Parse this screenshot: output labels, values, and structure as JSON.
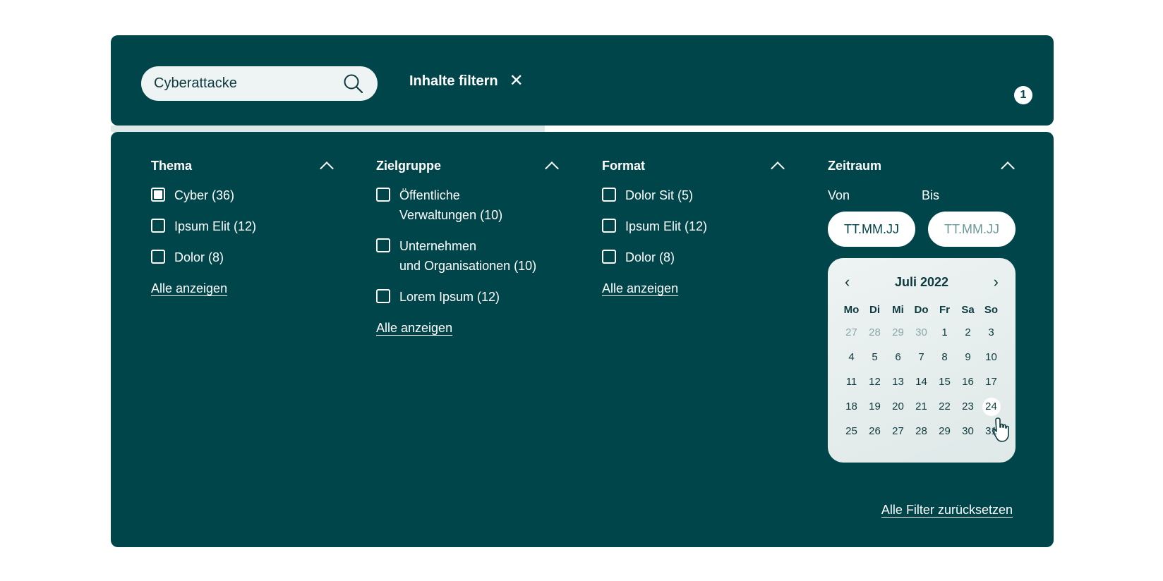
{
  "search": {
    "value": "Cyberattacke",
    "icon": "search-icon"
  },
  "filter_toggle": {
    "label": "Inhalte filtern",
    "close_icon": "✕"
  },
  "badge": {
    "count": "1"
  },
  "progress": {
    "fraction": 0.46
  },
  "columns": [
    {
      "title": "Thema",
      "options": [
        {
          "label": "Cyber  (36)",
          "checked": true
        },
        {
          "label": "Ipsum Elit  (12)",
          "checked": false
        },
        {
          "label": "Dolor  (8)",
          "checked": false
        }
      ],
      "show_all": "Alle anzeigen"
    },
    {
      "title": "Zielgruppe",
      "options": [
        {
          "label": "Öffentliche\nVerwaltungen   (10)",
          "checked": false
        },
        {
          "label": "Unternehmen\nund Organisationen  (10)",
          "checked": false
        },
        {
          "label": "Lorem Ipsum  (12)",
          "checked": false
        }
      ],
      "show_all": "Alle anzeigen"
    },
    {
      "title": "Format",
      "options": [
        {
          "label": "Dolor Sit  (5)",
          "checked": false
        },
        {
          "label": "Ipsum Elit  (12)",
          "checked": false
        },
        {
          "label": "Dolor  (8)",
          "checked": false
        }
      ],
      "show_all": "Alle anzeigen"
    }
  ],
  "zeitraum": {
    "title": "Zeitraum",
    "from_label": "Von",
    "to_label": "Bis",
    "from_placeholder": "TT.MM.JJ",
    "to_placeholder": "TT.MM.JJ",
    "calendar": {
      "month": "Juli 2022",
      "prev": "‹",
      "next": "›",
      "weekdays": [
        "Mo",
        "Di",
        "Mi",
        "Do",
        "Fr",
        "Sa",
        "So"
      ],
      "days": [
        {
          "d": "27",
          "m": true
        },
        {
          "d": "28",
          "m": true
        },
        {
          "d": "29",
          "m": true
        },
        {
          "d": "30",
          "m": true
        },
        {
          "d": "1"
        },
        {
          "d": "2"
        },
        {
          "d": "3"
        },
        {
          "d": "4"
        },
        {
          "d": "5"
        },
        {
          "d": "6"
        },
        {
          "d": "7"
        },
        {
          "d": "8"
        },
        {
          "d": "9"
        },
        {
          "d": "10"
        },
        {
          "d": "11"
        },
        {
          "d": "12"
        },
        {
          "d": "13"
        },
        {
          "d": "14"
        },
        {
          "d": "15"
        },
        {
          "d": "16"
        },
        {
          "d": "17"
        },
        {
          "d": "18"
        },
        {
          "d": "19"
        },
        {
          "d": "20"
        },
        {
          "d": "21"
        },
        {
          "d": "22"
        },
        {
          "d": "23"
        },
        {
          "d": "24",
          "hover": true
        },
        {
          "d": "25"
        },
        {
          "d": "26"
        },
        {
          "d": "27"
        },
        {
          "d": "28"
        },
        {
          "d": "29"
        },
        {
          "d": "30"
        },
        {
          "d": "31"
        }
      ]
    }
  },
  "reset": {
    "label": "Alle Filter zurücksetzen"
  },
  "colors": {
    "background": "#00454a",
    "accent": "#ffffff",
    "calendar_bg": "#eef3f3"
  }
}
